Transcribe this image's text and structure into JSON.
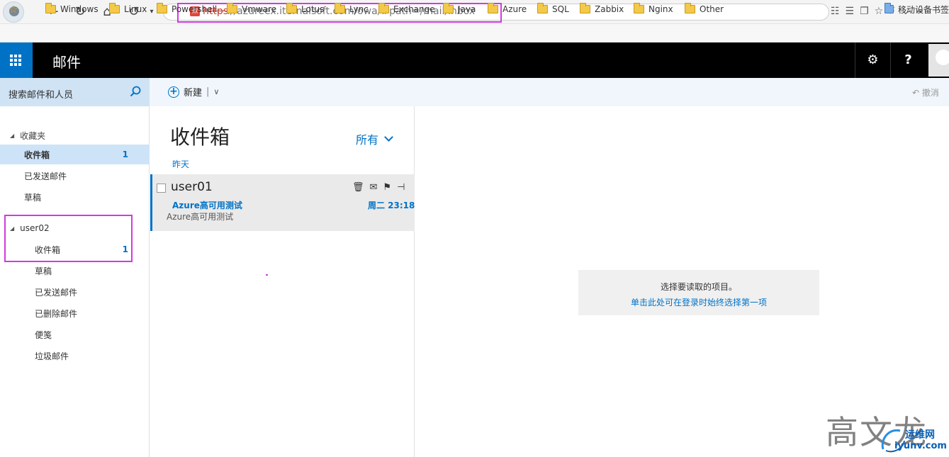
{
  "browser": {
    "url_protocol": "https",
    "url_rest": "://azureex.iternalsoft.com/owa/#path=/mail/inbox",
    "lock_glyph": "欺",
    "right_icons": "☷☰❐☆⚡⌄−"
  },
  "bookmarks": [
    {
      "label": "Windows"
    },
    {
      "label": "Linux"
    },
    {
      "label": "Powershell"
    },
    {
      "label": "Vmware"
    },
    {
      "label": "Lotus"
    },
    {
      "label": "Lync"
    },
    {
      "label": "Exchange"
    },
    {
      "label": "Java"
    },
    {
      "label": "Azure"
    },
    {
      "label": "SQL"
    },
    {
      "label": "Zabbix"
    },
    {
      "label": "Nginx"
    },
    {
      "label": "Other"
    },
    {
      "label": "移动设备书签"
    }
  ],
  "header": {
    "app_title": "邮件",
    "settings_glyph": "⚙",
    "help_glyph": "?"
  },
  "search": {
    "placeholder": "搜索邮件和人员"
  },
  "toolbar": {
    "new_label": "新建",
    "undo_label": "撤消"
  },
  "folders": {
    "favorites_label": "收藏夹",
    "favorites": [
      {
        "label": "收件箱",
        "count": "1"
      },
      {
        "label": "已发送邮件"
      },
      {
        "label": "草稿"
      }
    ],
    "account_label": "user02",
    "account_items": [
      {
        "label": "收件箱",
        "count": "1"
      },
      {
        "label": "草稿"
      },
      {
        "label": "已发送邮件"
      },
      {
        "label": "已删除邮件"
      },
      {
        "label": "便笺"
      },
      {
        "label": "垃圾邮件"
      }
    ]
  },
  "message_list": {
    "title": "收件箱",
    "filter_label": "所有",
    "group_header": "昨天",
    "messages": [
      {
        "sender": "user01",
        "subject": "Azure高可用测试",
        "preview": "Azure高可用测试",
        "time": "周二 23:18"
      }
    ]
  },
  "reading_pane": {
    "empty_title": "选择要读取的项目。",
    "empty_link": "单击此处可在登录时始终选择第一项"
  },
  "watermark": {
    "text": "高文龙",
    "logo_cn": "运维网",
    "logo_en": "iyunv.com"
  },
  "colors": {
    "accent": "#0072c6",
    "highlight": "#d13be0",
    "header_bg": "#000000"
  }
}
